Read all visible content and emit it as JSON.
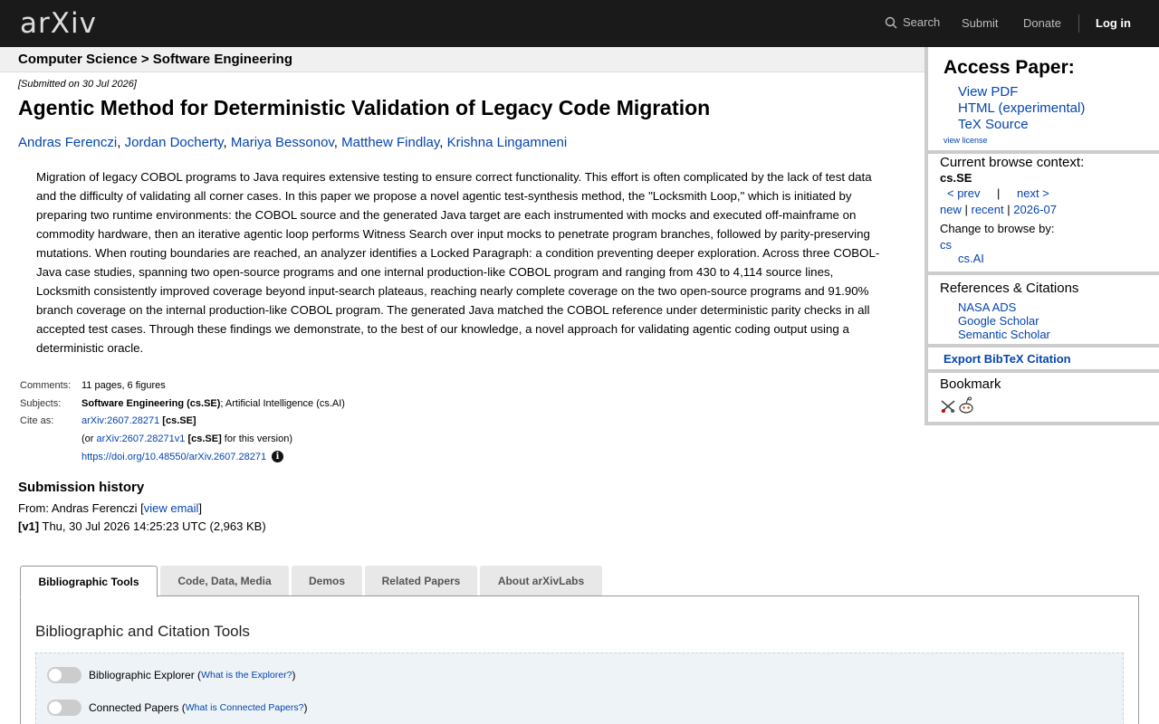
{
  "header": {
    "logo_text": "arXiv",
    "search_label": "Search",
    "submit_label": "Submit",
    "donate_label": "Donate",
    "login_label": "Log in"
  },
  "breadcrumb": "Computer Science > Software Engineering",
  "paper": {
    "submitted": "[Submitted on 30 Jul 2026]",
    "title": "Agentic Method for Deterministic Validation of Legacy Code Migration",
    "authors": [
      "Andras Ferenczi",
      "Jordan Docherty",
      "Mariya Bessonov",
      "Matthew Findlay",
      "Krishna Lingamneni"
    ],
    "abstract": "Migration of legacy COBOL programs to Java requires extensive testing to ensure correct functionality. This effort is often complicated by the lack of test data and the difficulty of validating all corner cases. In this paper we propose a novel agentic test-synthesis method, the \"Locksmith Loop,\" which is initiated by preparing two runtime environments: the COBOL source and the generated Java target are each instrumented with mocks and executed off-mainframe on commodity hardware, then an iterative agentic loop performs Witness Search over input mocks to penetrate program branches, followed by parity-preserving mutations. When routing boundaries are reached, an analyzer identifies a Locked Paragraph: a condition preventing deeper exploration. Across three COBOL-Java case studies, spanning two open-source programs and one internal production-like COBOL program and ranging from 430 to 4,114 source lines, Locksmith consistently improved coverage beyond input-search plateaus, reaching nearly complete coverage on the two open-source programs and 91.90% branch coverage on the internal production-like COBOL program. The generated Java matched the COBOL reference under deterministic parity checks in all accepted test cases. Through these findings we demonstrate, to the best of our knowledge, a novel approach for validating agentic coding output using a deterministic oracle."
  },
  "meta": {
    "comments_label": "Comments:",
    "comments": "11 pages, 6 figures",
    "subjects_label": "Subjects:",
    "subjects_primary": "Software Engineering (cs.SE)",
    "subjects_rest": "; Artificial Intelligence (cs.AI)",
    "cite_label": "Cite as:",
    "cite_id": "arXiv:2607.28271",
    "cite_cat": "[cs.SE]",
    "or_prefix": "(or",
    "cite_version": "arXiv:2607.28271v1",
    "cite_version_cat": "[cs.SE]",
    "cite_version_suffix": "for this version)",
    "doi": "https://doi.org/10.48550/arXiv.2607.28271"
  },
  "history": {
    "heading": "Submission history",
    "from_prefix": "From: Andras Ferenczi [",
    "view_email": "view email",
    "from_suffix": "]",
    "v1_label": "[v1]",
    "v1_text": " Thu, 30 Jul 2026 14:25:23 UTC (2,963 KB)"
  },
  "tabs": [
    "Bibliographic Tools",
    "Code, Data, Media",
    "Demos",
    "Related Papers",
    "About arXivLabs"
  ],
  "tools": {
    "panel_title": "Bibliographic and Citation Tools",
    "explorer_label": "Bibliographic Explorer (",
    "explorer_help": "What is the Explorer?",
    "connected_label": "Connected Papers (",
    "connected_help": "What is Connected Papers?",
    "close_paren": ")"
  },
  "sidebar": {
    "access_title": "Access Paper:",
    "view_pdf": "View PDF",
    "html": "HTML (experimental)",
    "tex": "TeX Source",
    "license": "view license",
    "context_title": "Current browse context:",
    "context_value": "cs.SE",
    "prev": "< prev",
    "pipe": "|",
    "next": "next >",
    "new": "new",
    "recent": "recent",
    "month": "2026-07",
    "change_label": "Change to browse by:",
    "cs": "cs",
    "cs_ai": "cs.AI",
    "refs_title": "References & Citations",
    "nasa": "NASA ADS",
    "scholar": "Google Scholar",
    "semantic": "Semantic Scholar",
    "bibtex": "Export BibTeX Citation",
    "bookmark": "Bookmark"
  }
}
